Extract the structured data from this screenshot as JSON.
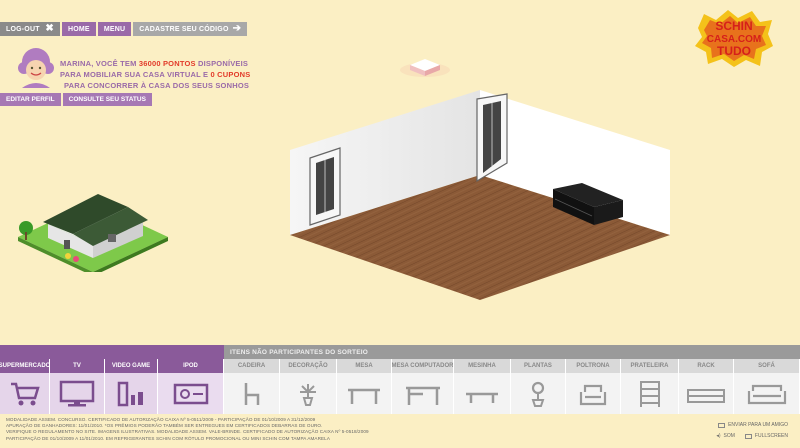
{
  "nav": {
    "logout": "LOG-OUT",
    "home": "HOME",
    "menu": "MENU",
    "register_code": "CADASTRE SEU CÓDIGO"
  },
  "user": {
    "line1_prefix": "MARINA, VOCÊ TEM ",
    "points": "36000 PONTOS",
    "line1_suffix": " DISPONÍVEIS",
    "line2_prefix": "PARA MOBILIAR SUA CASA VIRTUAL E ",
    "coupons": "0 CUPONS",
    "line3": "PARA CONCORRER À CASA DOS SEUS SONHOS"
  },
  "subnav": {
    "edit_profile": "EDITAR PERFIL",
    "check_status": "CONSULTE SEU STATUS"
  },
  "logo": {
    "line1": "SCHIN",
    "line2": "CASA.COM",
    "line3": "TUDO"
  },
  "categories_header": "ITENS NÃO PARTICIPANTES DO SORTEIO",
  "categories": [
    {
      "label": "SUPERMERCADO",
      "icon": "shopping-cart-icon",
      "participating": true
    },
    {
      "label": "TV",
      "icon": "tv-icon",
      "participating": true
    },
    {
      "label": "VIDEO GAME",
      "icon": "video-game-icon",
      "participating": true
    },
    {
      "label": "IPOD",
      "icon": "ipod-icon",
      "participating": true
    },
    {
      "label": "CADEIRA",
      "icon": "chair-icon",
      "participating": false
    },
    {
      "label": "DECORAÇÃO",
      "icon": "decoration-icon",
      "participating": false
    },
    {
      "label": "MESA",
      "icon": "table-icon",
      "participating": false
    },
    {
      "label": "MESA COMPUTADOR",
      "icon": "computer-desk-icon",
      "participating": false
    },
    {
      "label": "MESINHA",
      "icon": "small-table-icon",
      "participating": false
    },
    {
      "label": "PLANTAS",
      "icon": "plant-icon",
      "participating": false
    },
    {
      "label": "POLTRONA",
      "icon": "armchair-icon",
      "participating": false
    },
    {
      "label": "PRATELEIRA",
      "icon": "shelf-icon",
      "participating": false
    },
    {
      "label": "RACK",
      "icon": "rack-icon",
      "participating": false
    },
    {
      "label": "SOFÁ",
      "icon": "sofa-icon",
      "participating": false
    }
  ],
  "footer": {
    "line1": "MODALIDADE ASSEM. CONCURSO. CERTIFICADO DE AUTORIZAÇÃO CAIXA Nº 5-0511/2009 - PARTICIPAÇÃO DE 01/10/2009 A 31/12/2009",
    "line2": "APURAÇÃO DE GANHADORES: 11/01/2010. *OS PRÊMIOS PODERÃO TAMBÉM SER ENTREGUES EM CERTIFICADOS DEBARRAS DE OURO.",
    "line3": "VERIFIQUE O REGULAMENTO NO SITE. IMAGENS ILUSTRATIVAS. MODALIDADE ASSEM. VALE-BRINDE. CERTIFICADO DE AUTORIZAÇÃO CAIXA Nº 5-0518/2009",
    "line4": "PARTICIPAÇÃO DE 01/10/2009 A 11/01/2010. EM REFRIGERANTES SCHIN COM RÓTULO PROMOCIONAL OU MINI SCHIN COM TAMPA AMARELA"
  },
  "links": {
    "send_friend": "ENVIAR PARA UM AMIGO",
    "sound": "SOM",
    "fullscreen": "FULLSCREEN"
  },
  "colors": {
    "background": "#fbefc4",
    "purple": "#9a6aa8",
    "accent_red": "#e23b2a",
    "floor": "#8a5a38"
  }
}
